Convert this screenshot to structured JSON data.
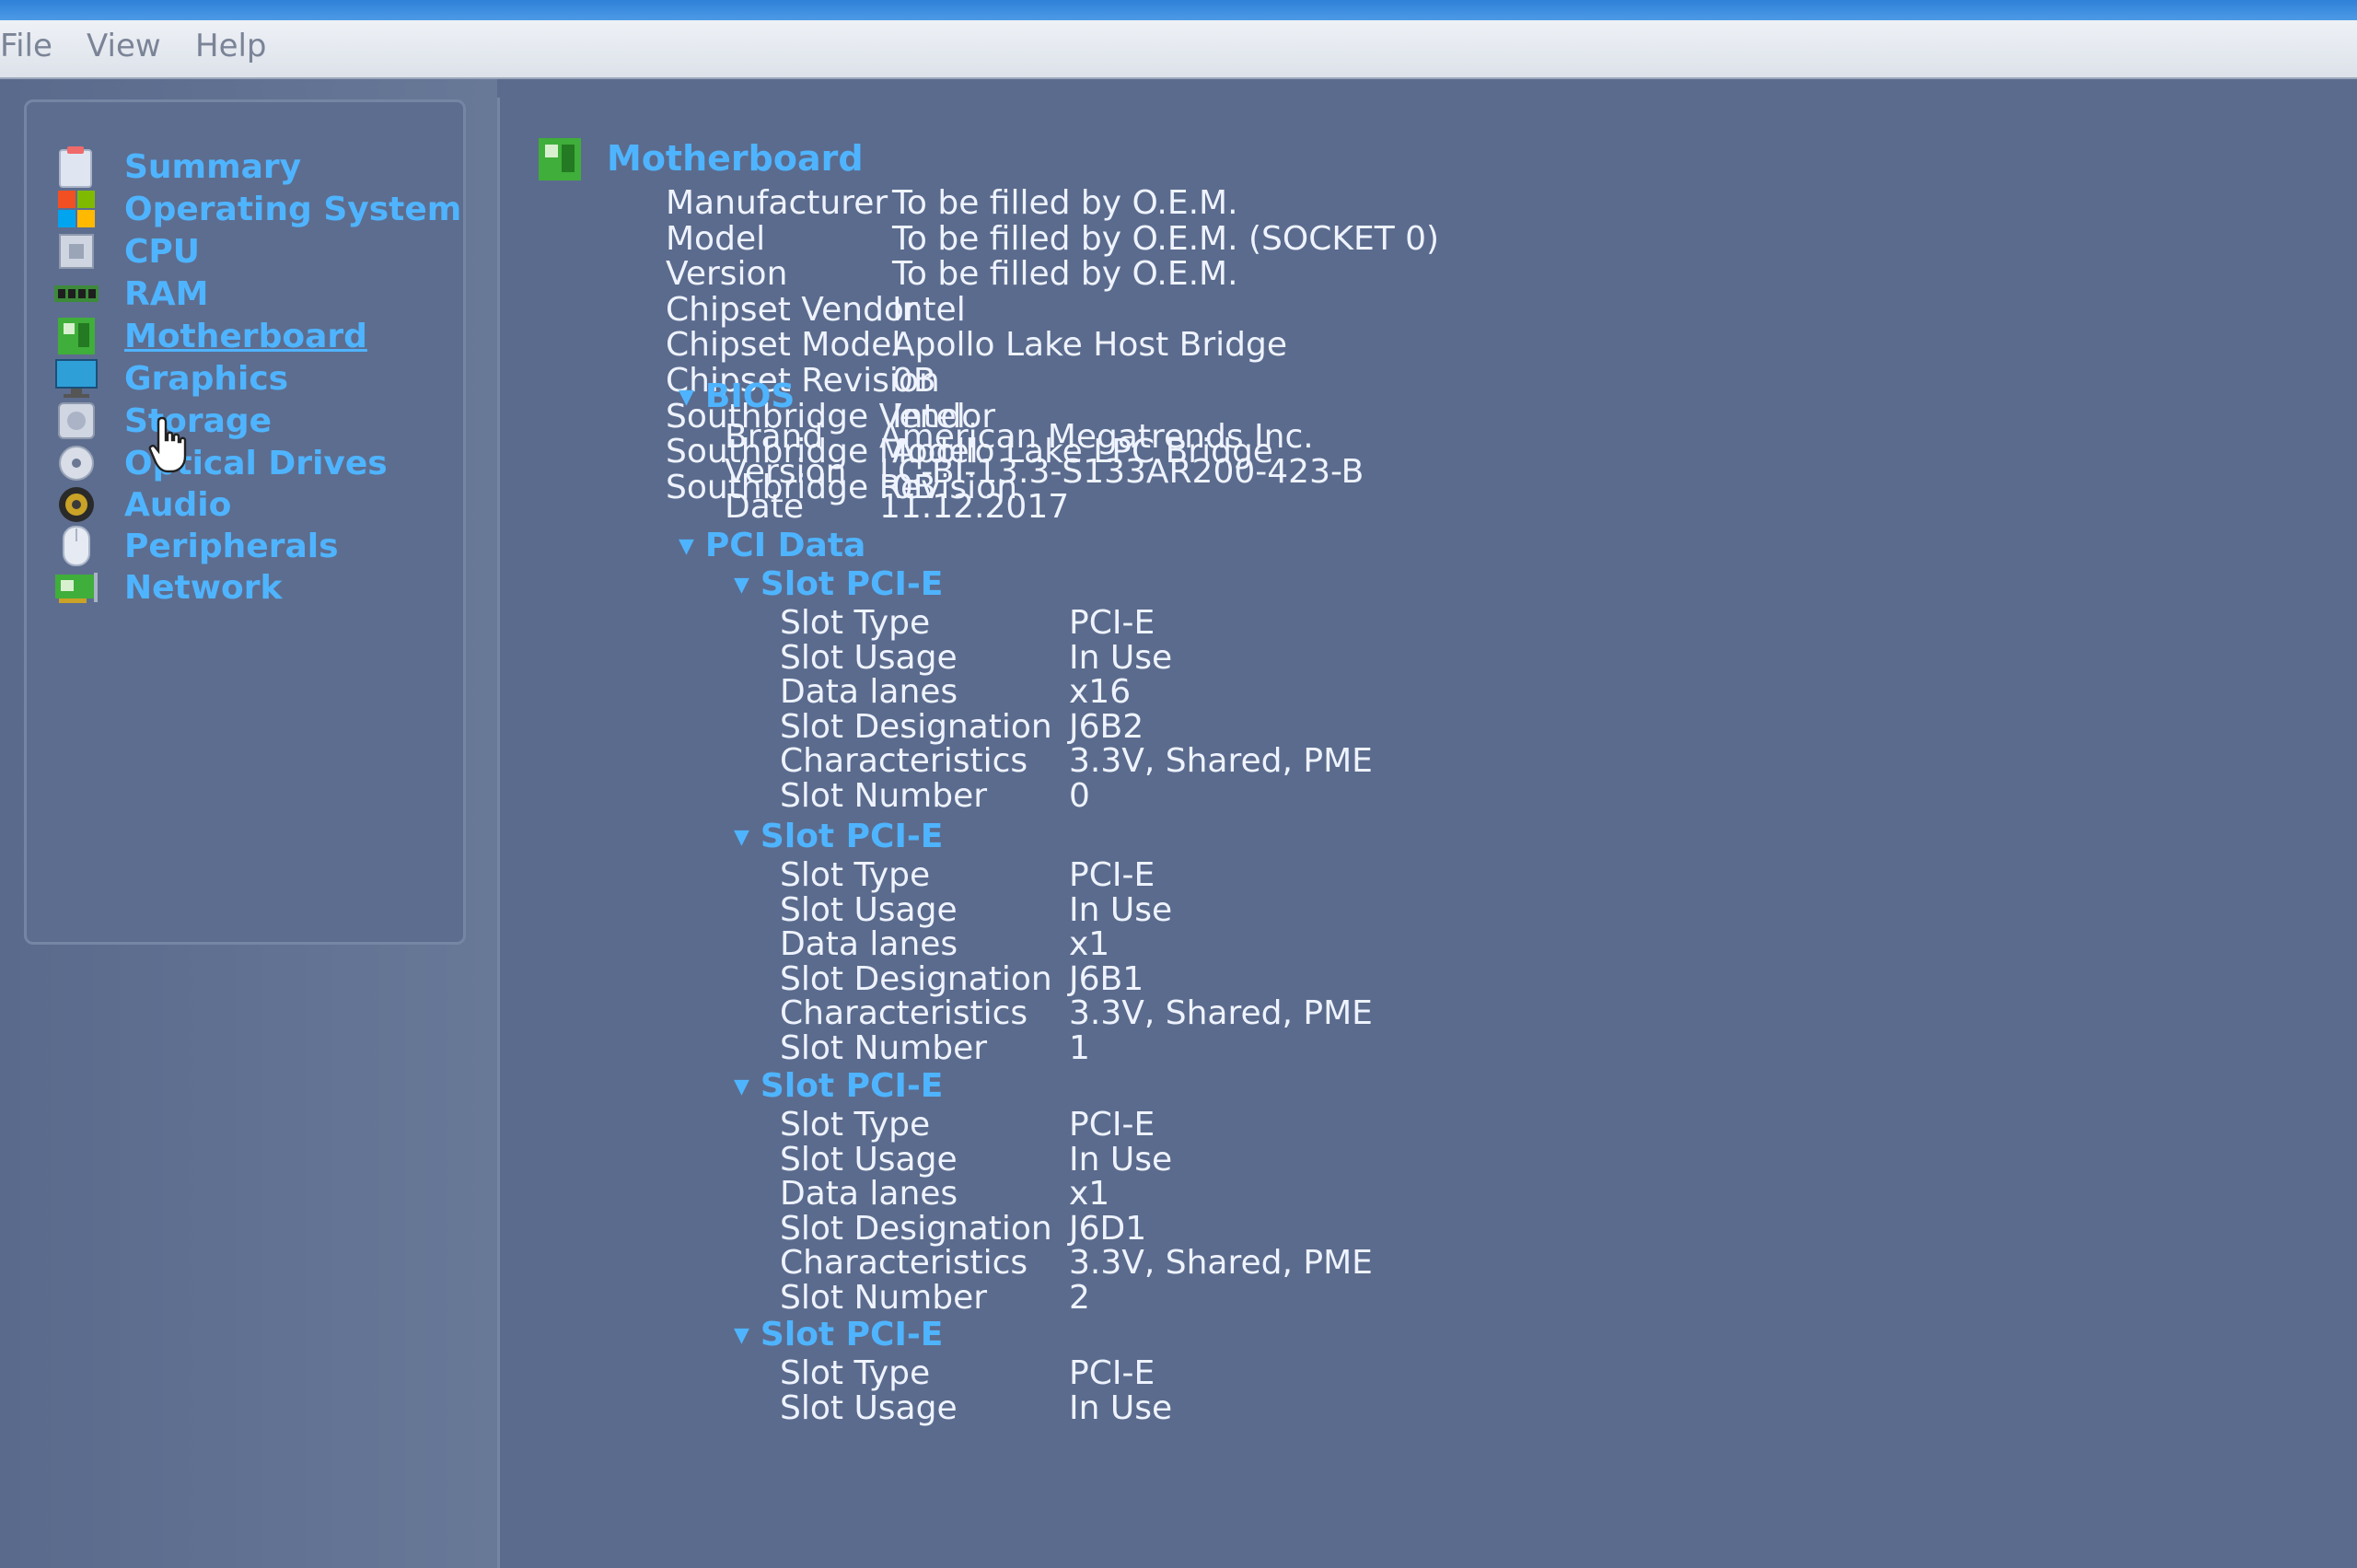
{
  "menubar": {
    "items": [
      "File",
      "View",
      "Help"
    ]
  },
  "sidebar": {
    "items": [
      {
        "label": "Summary",
        "icon": "summary-icon"
      },
      {
        "label": "Operating System",
        "icon": "windows-logo-icon"
      },
      {
        "label": "CPU",
        "icon": "cpu-chip-icon"
      },
      {
        "label": "RAM",
        "icon": "ram-module-icon"
      },
      {
        "label": "Motherboard",
        "icon": "motherboard-icon"
      },
      {
        "label": "Graphics",
        "icon": "monitor-icon"
      },
      {
        "label": "Storage",
        "icon": "hard-drive-icon"
      },
      {
        "label": "Optical Drives",
        "icon": "optical-disc-icon"
      },
      {
        "label": "Audio",
        "icon": "speaker-icon"
      },
      {
        "label": "Peripherals",
        "icon": "mouse-icon"
      },
      {
        "label": "Network",
        "icon": "network-card-icon"
      }
    ],
    "active": "Motherboard"
  },
  "main": {
    "title": "Motherboard",
    "properties": [
      {
        "key": "Manufacturer",
        "value": "To be filled by O.E.M."
      },
      {
        "key": "Model",
        "value": "To be filled by O.E.M. (SOCKET 0)"
      },
      {
        "key": "Version",
        "value": "To be filled by O.E.M."
      },
      {
        "key": "Chipset Vendor",
        "value": "Intel"
      },
      {
        "key": "Chipset Model",
        "value": "Apollo Lake Host Bridge"
      },
      {
        "key": "Chipset Revision",
        "value": "0B"
      },
      {
        "key": "Southbridge Vendor",
        "value": "Intel"
      },
      {
        "key": "Southbridge Model",
        "value": "Apollo Lake LPC Bridge"
      },
      {
        "key": "Southbridge Revision",
        "value": "0B"
      }
    ],
    "bios": {
      "label": "BIOS",
      "properties": [
        {
          "key": "Brand",
          "value": "American Megatrends Inc."
        },
        {
          "key": "Version",
          "value": "LC-BI-13.3-S133AR200-423-B"
        },
        {
          "key": "Date",
          "value": "11.12.2017"
        }
      ]
    },
    "pci": {
      "label": "PCI Data",
      "slots": [
        {
          "label": "Slot PCI-E",
          "properties": [
            {
              "key": "Slot Type",
              "value": "PCI-E"
            },
            {
              "key": "Slot Usage",
              "value": "In Use"
            },
            {
              "key": "Data lanes",
              "value": "x16"
            },
            {
              "key": "Slot Designation",
              "value": "J6B2"
            },
            {
              "key": "Characteristics",
              "value": "3.3V, Shared, PME"
            },
            {
              "key": "Slot Number",
              "value": "0"
            }
          ]
        },
        {
          "label": "Slot PCI-E",
          "properties": [
            {
              "key": "Slot Type",
              "value": "PCI-E"
            },
            {
              "key": "Slot Usage",
              "value": "In Use"
            },
            {
              "key": "Data lanes",
              "value": "x1"
            },
            {
              "key": "Slot Designation",
              "value": "J6B1"
            },
            {
              "key": "Characteristics",
              "value": "3.3V, Shared, PME"
            },
            {
              "key": "Slot Number",
              "value": "1"
            }
          ]
        },
        {
          "label": "Slot PCI-E",
          "properties": [
            {
              "key": "Slot Type",
              "value": "PCI-E"
            },
            {
              "key": "Slot Usage",
              "value": "In Use"
            },
            {
              "key": "Data lanes",
              "value": "x1"
            },
            {
              "key": "Slot Designation",
              "value": "J6D1"
            },
            {
              "key": "Characteristics",
              "value": "3.3V, Shared, PME"
            },
            {
              "key": "Slot Number",
              "value": "2"
            }
          ]
        },
        {
          "label": "Slot PCI-E",
          "properties": [
            {
              "key": "Slot Type",
              "value": "PCI-E"
            },
            {
              "key": "Slot Usage",
              "value": "In Use"
            }
          ]
        }
      ]
    }
  }
}
